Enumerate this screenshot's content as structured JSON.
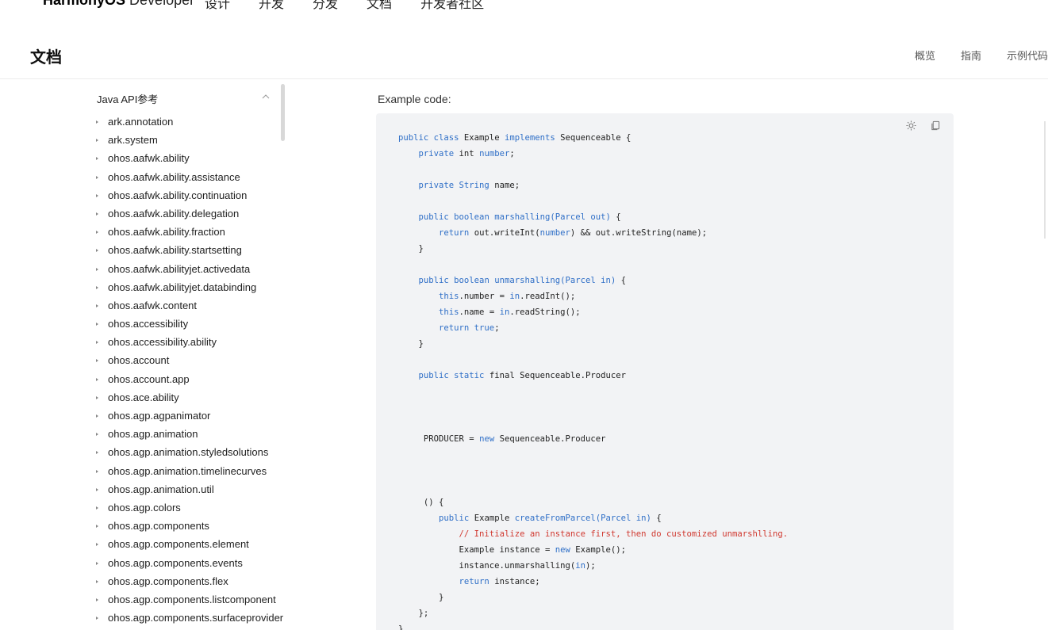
{
  "topnav": {
    "brand_main": "HarmonyOS",
    "brand_sub": "Developer",
    "links": [
      "设计",
      "开发",
      "分发",
      "文档",
      "开发者社区"
    ]
  },
  "subheader": {
    "title": "文档",
    "tabs": [
      "概览",
      "指南",
      "示例代码"
    ]
  },
  "sidebar": {
    "section_title": "Java API参考",
    "items": [
      "ark.annotation",
      "ark.system",
      "ohos.aafwk.ability",
      "ohos.aafwk.ability.assistance",
      "ohos.aafwk.ability.continuation",
      "ohos.aafwk.ability.delegation",
      "ohos.aafwk.ability.fraction",
      "ohos.aafwk.ability.startsetting",
      "ohos.aafwk.abilityjet.activedata",
      "ohos.aafwk.abilityjet.databinding",
      "ohos.aafwk.content",
      "ohos.accessibility",
      "ohos.accessibility.ability",
      "ohos.account",
      "ohos.account.app",
      "ohos.ace.ability",
      "ohos.agp.agpanimator",
      "ohos.agp.animation",
      "ohos.agp.animation.styledsolutions",
      "ohos.agp.animation.timelinecurves",
      "ohos.agp.animation.util",
      "ohos.agp.colors",
      "ohos.agp.components",
      "ohos.agp.components.element",
      "ohos.agp.components.events",
      "ohos.agp.components.flex",
      "ohos.agp.components.listcomponent",
      "ohos.agp.components.surfaceprovider"
    ]
  },
  "content": {
    "example_label": "Example code:",
    "code_lines": [
      [
        [
          "kw",
          "public class "
        ],
        [
          "",
          "Example "
        ],
        [
          "kw",
          "implements "
        ],
        [
          "",
          "Sequenceable {"
        ]
      ],
      [
        [
          "",
          "    "
        ],
        [
          "kw",
          "private "
        ],
        [
          "",
          "int "
        ],
        [
          "kw",
          "number"
        ],
        [
          "",
          ";"
        ]
      ],
      [
        [
          "",
          "    "
        ],
        [
          "kw",
          "private "
        ],
        [
          "kw",
          "String "
        ],
        [
          "",
          "name;"
        ]
      ],
      [
        [
          "",
          "    "
        ],
        [
          "kw",
          "public "
        ],
        [
          "kw",
          "boolean "
        ],
        [
          "kw",
          "marshalling"
        ],
        [
          "kw",
          "(Parcel out) "
        ],
        [
          "",
          "{"
        ]
      ],
      [
        [
          "",
          "        "
        ],
        [
          "kw",
          "return "
        ],
        [
          "",
          "out.writeInt("
        ],
        [
          "kw",
          "number"
        ],
        [
          "",
          ") && out.writeString(name);"
        ]
      ],
      [
        [
          "",
          "    }"
        ]
      ],
      [
        [
          "",
          "    "
        ],
        [
          "kw",
          "public "
        ],
        [
          "kw",
          "boolean "
        ],
        [
          "kw",
          "unmarshalling"
        ],
        [
          "kw",
          "(Parcel in) "
        ],
        [
          "",
          "{"
        ]
      ],
      [
        [
          "",
          "        "
        ],
        [
          "kw",
          "this"
        ],
        [
          "",
          ".number = "
        ],
        [
          "kw",
          "in"
        ],
        [
          "",
          ".readInt();"
        ]
      ],
      [
        [
          "",
          "        "
        ],
        [
          "kw",
          "this"
        ],
        [
          "",
          ".name = "
        ],
        [
          "kw",
          "in"
        ],
        [
          "",
          ".readString();"
        ]
      ],
      [
        [
          "",
          "        "
        ],
        [
          "kw",
          "return true"
        ],
        [
          "",
          ";"
        ]
      ],
      [
        [
          "",
          "    }"
        ]
      ],
      [
        [
          "",
          "    "
        ],
        [
          "kw",
          "public static "
        ],
        [
          "",
          "final Sequenceable.Producer"
        ]
      ],
      [
        [
          "",
          "     PRODUCER = "
        ],
        [
          "kw",
          "new "
        ],
        [
          "",
          "Sequenceable.Producer"
        ]
      ],
      [
        [
          "",
          "     () {"
        ]
      ],
      [
        [
          "",
          "        "
        ],
        [
          "kw",
          "public "
        ],
        [
          "",
          "Example "
        ],
        [
          "kw",
          "createFromParcel(Parcel in) "
        ],
        [
          "",
          "{"
        ]
      ],
      [
        [
          "",
          "            "
        ],
        [
          "cm",
          "// Initialize an instance first, then do customized unmarshlling."
        ]
      ],
      [
        [
          "",
          "            Example instance = "
        ],
        [
          "kw",
          "new "
        ],
        [
          "",
          "Example();"
        ]
      ],
      [
        [
          "",
          "            instance.unmarshalling("
        ],
        [
          "kw",
          "in"
        ],
        [
          "",
          ");"
        ]
      ],
      [
        [
          "",
          "            "
        ],
        [
          "kw",
          "return "
        ],
        [
          "",
          "instance;"
        ]
      ],
      [
        [
          "",
          "        }"
        ]
      ],
      [
        [
          "",
          "    };"
        ]
      ],
      [
        [
          "",
          "}"
        ]
      ]
    ]
  },
  "colors": {
    "keyword": "#2f6fc7",
    "comment": "#d0382f",
    "code_bg": "#f2f3f5"
  }
}
